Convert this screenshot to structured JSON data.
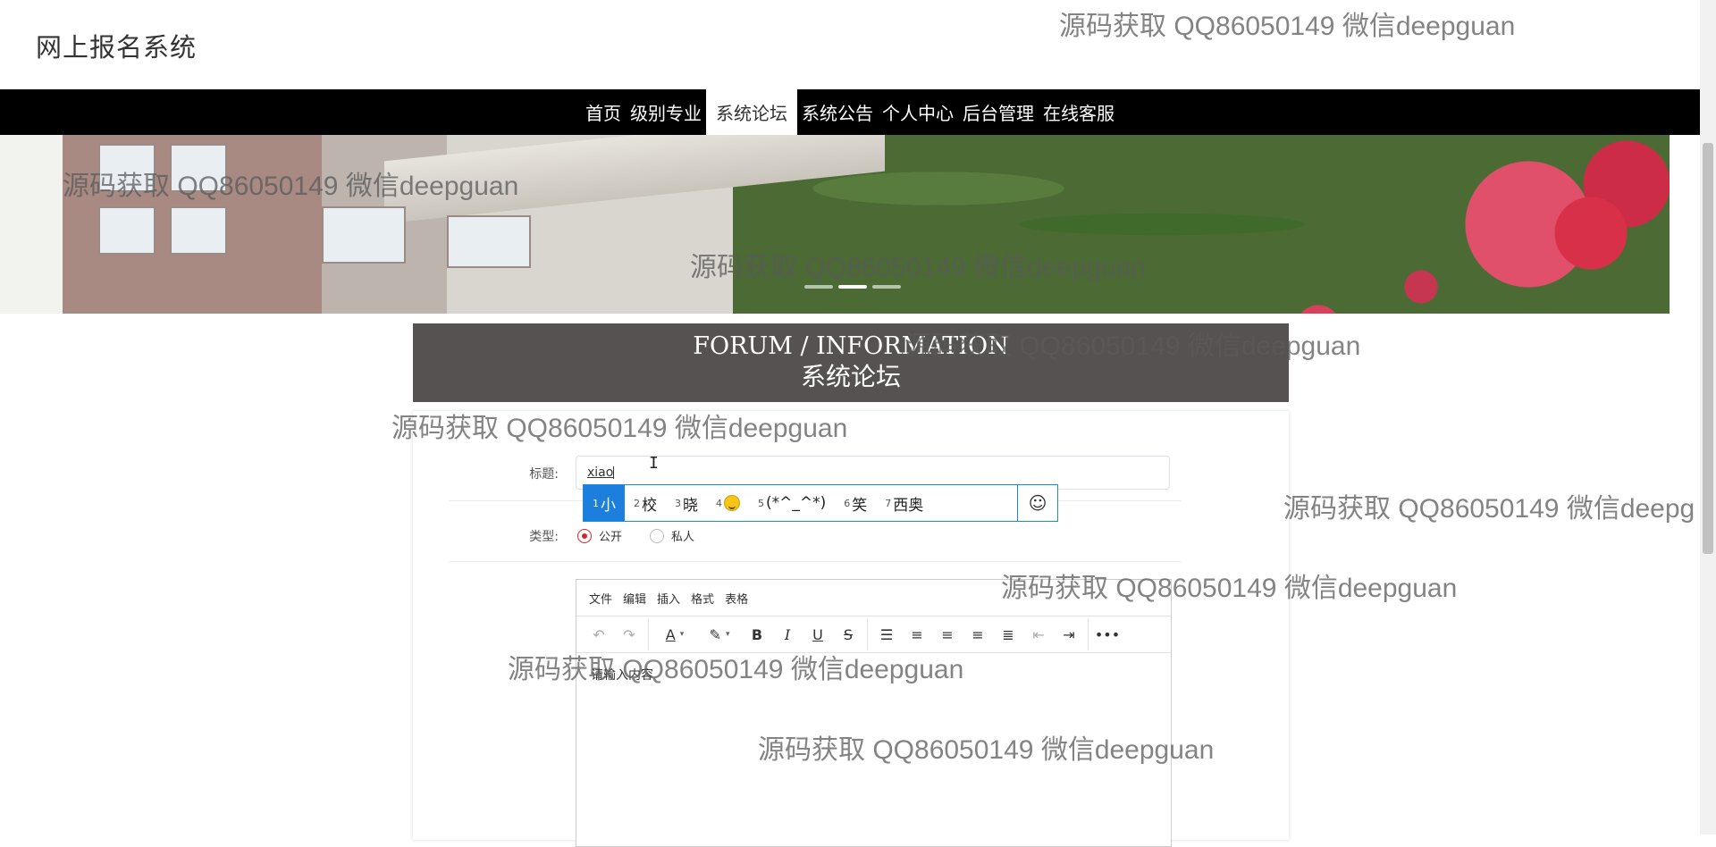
{
  "site": {
    "title": "网上报名系统"
  },
  "nav": {
    "items": [
      {
        "label": "首页"
      },
      {
        "label": "级别专业"
      },
      {
        "label": "系统论坛",
        "active": true
      },
      {
        "label": "系统公告"
      },
      {
        "label": "个人中心"
      },
      {
        "label": "后台管理"
      },
      {
        "label": "在线客服"
      }
    ]
  },
  "section": {
    "title_en": "FORUM / INFORMATION",
    "title_cn": "系统论坛"
  },
  "form": {
    "title_label": "标题:",
    "title_value": "xiao",
    "type_label": "类型:",
    "type_options": [
      {
        "label": "公开",
        "checked": true
      },
      {
        "label": "私人",
        "checked": false
      }
    ]
  },
  "ime": {
    "candidates": [
      {
        "num": "1",
        "text": "小"
      },
      {
        "num": "2",
        "text": "校"
      },
      {
        "num": "3",
        "text": "晓"
      },
      {
        "num": "4",
        "text": "",
        "icon": "smiley-emoji-icon"
      },
      {
        "num": "5",
        "text": "(*^_^*)"
      },
      {
        "num": "6",
        "text": "笑"
      },
      {
        "num": "7",
        "text": "西奥"
      }
    ],
    "emoji_button": "☺"
  },
  "editor": {
    "menus": [
      "文件",
      "编辑",
      "插入",
      "格式",
      "表格"
    ],
    "toolbar": [
      "undo-icon",
      "redo-icon",
      "text-color-icon",
      "highlight-color-icon",
      "bold-icon",
      "italic-icon",
      "underline-icon",
      "strikethrough-icon",
      "bullet-list-icon",
      "align-left-icon",
      "align-center-icon",
      "align-right-icon",
      "justify-icon",
      "outdent-icon",
      "indent-icon",
      "more-icon"
    ],
    "placeholder": "请输入内容"
  },
  "watermarks": [
    "源码获取 QQ86050149 微信deepguan",
    "源码获取 QQ86050149 微信deepguan",
    "源码获取 QQ86050149 微信deepguan",
    "源码获取 QQ86050149 微信deepguan",
    "源码获取 QQ86050149 微信deepguan",
    "源码获取 QQ86050149 微信deepguan",
    "源码获取 QQ86050149 微信deepg",
    "源码获取 QQ86050149 微信deepguan",
    "源码获取 QQ86050149 微信deepguan",
    "源码获取 QQ86050149 微信deepguan"
  ],
  "colors": {
    "navbar": "#000000",
    "header_bg": "#575252",
    "ime_selected": "#1c7fdd",
    "radio_checked": "#d9242b"
  }
}
